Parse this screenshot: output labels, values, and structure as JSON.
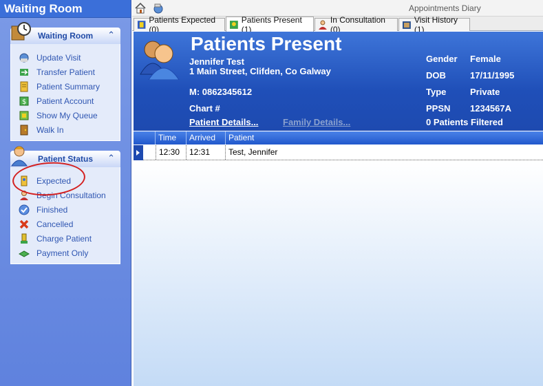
{
  "left_pane": {
    "title": "Waiting Room",
    "waiting_room_panel": {
      "title": "Waiting Room",
      "items": [
        {
          "label": "Update Visit",
          "icon": "update-visit-icon"
        },
        {
          "label": "Transfer Patient",
          "icon": "transfer-patient-icon"
        },
        {
          "label": "Patient Summary",
          "icon": "patient-summary-icon"
        },
        {
          "label": "Patient Account",
          "icon": "patient-account-icon"
        },
        {
          "label": "Show My Queue",
          "icon": "show-queue-icon"
        },
        {
          "label": "Walk In",
          "icon": "walk-in-icon"
        }
      ]
    },
    "patient_status_panel": {
      "title": "Patient Status",
      "items": [
        {
          "label": "Expected",
          "icon": "expected-icon"
        },
        {
          "label": "Begin Consultation",
          "icon": "begin-consultation-icon"
        },
        {
          "label": "Finished",
          "icon": "finished-icon"
        },
        {
          "label": "Cancelled",
          "icon": "cancelled-icon"
        },
        {
          "label": "Charge Patient",
          "icon": "charge-patient-icon"
        },
        {
          "label": "Payment Only",
          "icon": "payment-only-icon"
        }
      ]
    }
  },
  "topbar": {
    "title": "Appointments Diary"
  },
  "tabs": [
    {
      "label": "Patients Expected (0)"
    },
    {
      "label": "Patients Present (1)"
    },
    {
      "label": "In Consultation (0)"
    },
    {
      "label": "Visit History (1)"
    }
  ],
  "header": {
    "title": "Patients Present",
    "patient_name": "Jennifer Test",
    "address": "1 Main Street, Clifden, Co Galway",
    "mobile": "M: 0862345612",
    "chart_label": "Chart #",
    "patient_details_link": "Patient Details...",
    "family_details_link": "Family Details...",
    "gender_label": "Gender",
    "gender_value": "Female",
    "dob_label": "DOB",
    "dob_value": "17/11/1995",
    "type_label": "Type",
    "type_value": "Private",
    "ppsn_label": "PPSN",
    "ppsn_value": "1234567A",
    "filtered": "0 Patients Filtered"
  },
  "grid": {
    "columns": [
      "Time",
      "Arrived",
      "Patient"
    ],
    "sort_indicator": "△",
    "rows": [
      {
        "time": "12:30",
        "arrived": "12:31",
        "patient": "Test, Jennifer"
      }
    ]
  },
  "colors": {
    "annotation": "#d42020",
    "header_blue": "#1f4fb8"
  }
}
